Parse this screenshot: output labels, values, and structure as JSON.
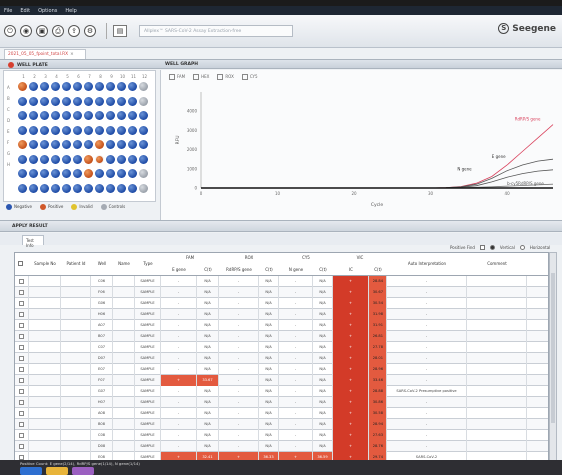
{
  "menu": [
    "File",
    "Edit",
    "Options",
    "Help"
  ],
  "assay_placeholder": "Allplex™ SARS-CoV-2 Assay Extraction-free",
  "brand": "Seegene",
  "doc_tab": "2021_05_05_fpoint_total.RX",
  "panels": {
    "well_plate": "WELL PLATE",
    "well_graph": "WELL GRAPH",
    "apply_result": "APPLY RESULT"
  },
  "chart_checks": [
    "FAM",
    "HEX",
    "ROX",
    "CY5"
  ],
  "plate": {
    "columns": [
      "1",
      "2",
      "3",
      "4",
      "5",
      "6",
      "7",
      "8",
      "9",
      "10",
      "11",
      "12"
    ],
    "rows": [
      "A",
      "B",
      "C",
      "D",
      "E",
      "F",
      "G",
      "H"
    ]
  },
  "plate_legend": [
    "Negative",
    "Positive",
    "Invalid",
    "Controls"
  ],
  "tab_test_info": "Test Info",
  "view_options": {
    "positive_find": "Positive Find",
    "vertical": "Vertical",
    "horizontal": "Horizontal"
  },
  "table": {
    "group_headers": [
      "FAM",
      "ROX",
      "CY5",
      "VIC"
    ],
    "headers": [
      "Sample No",
      "Patient Id",
      "Well",
      "Name",
      "Type",
      "E gene",
      "C(t)",
      "RdRP/S gene",
      "C(t)",
      "N gene",
      "C(t)",
      "IC",
      "C(t)",
      "Auto Interpretation",
      "Comment"
    ],
    "rows": [
      {
        "well": "C06",
        "type": "SAMPLE",
        "e": "-",
        "ect": "N/A",
        "r": "-",
        "rct": "N/A",
        "n": "-",
        "nct": "N/A",
        "ic": "+",
        "icct": "28.84",
        "interp": "-",
        "hl": []
      },
      {
        "well": "F06",
        "type": "SAMPLE",
        "e": "-",
        "ect": "N/A",
        "r": "-",
        "rct": "N/A",
        "n": "-",
        "nct": "N/A",
        "ic": "+",
        "icct": "30.67",
        "interp": "-",
        "hl": []
      },
      {
        "well": "G06",
        "type": "SAMPLE",
        "e": "-",
        "ect": "N/A",
        "r": "-",
        "rct": "N/A",
        "n": "-",
        "nct": "N/A",
        "ic": "+",
        "icct": "30.54",
        "interp": "-",
        "hl": []
      },
      {
        "well": "H06",
        "type": "SAMPLE",
        "e": "-",
        "ect": "N/A",
        "r": "-",
        "rct": "N/A",
        "n": "-",
        "nct": "N/A",
        "ic": "+",
        "icct": "31.98",
        "interp": "-",
        "hl": []
      },
      {
        "well": "A07",
        "type": "SAMPLE",
        "e": "-",
        "ect": "N/A",
        "r": "-",
        "rct": "N/A",
        "n": "-",
        "nct": "N/A",
        "ic": "+",
        "icct": "31.91",
        "interp": "-",
        "hl": []
      },
      {
        "well": "B07",
        "type": "SAMPLE",
        "e": "-",
        "ect": "N/A",
        "r": "-",
        "rct": "N/A",
        "n": "-",
        "nct": "N/A",
        "ic": "+",
        "icct": "26.81",
        "interp": "-",
        "hl": []
      },
      {
        "well": "C07",
        "type": "SAMPLE",
        "e": "-",
        "ect": "N/A",
        "r": "-",
        "rct": "N/A",
        "n": "-",
        "nct": "N/A",
        "ic": "+",
        "icct": "27.78",
        "interp": "-",
        "hl": []
      },
      {
        "well": "D07",
        "type": "SAMPLE",
        "e": "-",
        "ect": "N/A",
        "r": "-",
        "rct": "N/A",
        "n": "-",
        "nct": "N/A",
        "ic": "+",
        "icct": "28.01",
        "interp": "-",
        "hl": []
      },
      {
        "well": "E07",
        "type": "SAMPLE",
        "e": "-",
        "ect": "N/A",
        "r": "-",
        "rct": "N/A",
        "n": "-",
        "nct": "N/A",
        "ic": "+",
        "icct": "28.96",
        "interp": "-",
        "hl": []
      },
      {
        "well": "F07",
        "type": "SAMPLE",
        "e": "+",
        "ect": "33.67",
        "r": "-",
        "rct": "N/A",
        "n": "-",
        "nct": "N/A",
        "ic": "+",
        "icct": "33.46",
        "interp": "-",
        "hl": [
          "e"
        ]
      },
      {
        "well": "G07",
        "type": "SAMPLE",
        "e": "-",
        "ect": "N/A",
        "r": "-",
        "rct": "N/A",
        "n": "-",
        "nct": "N/A",
        "ic": "+",
        "icct": "28.88",
        "interp": "SARS-CoV-2 Presumptive positive",
        "hl": []
      },
      {
        "well": "H07",
        "type": "SAMPLE",
        "e": "-",
        "ect": "N/A",
        "r": "-",
        "rct": "N/A",
        "n": "-",
        "nct": "N/A",
        "ic": "+",
        "icct": "30.86",
        "interp": "-",
        "hl": []
      },
      {
        "well": "A08",
        "type": "SAMPLE",
        "e": "-",
        "ect": "N/A",
        "r": "-",
        "rct": "N/A",
        "n": "-",
        "nct": "N/A",
        "ic": "+",
        "icct": "30.58",
        "interp": "-",
        "hl": []
      },
      {
        "well": "B08",
        "type": "SAMPLE",
        "e": "-",
        "ect": "N/A",
        "r": "-",
        "rct": "N/A",
        "n": "-",
        "nct": "N/A",
        "ic": "+",
        "icct": "28.94",
        "interp": "-",
        "hl": []
      },
      {
        "well": "C08",
        "type": "SAMPLE",
        "e": "-",
        "ect": "N/A",
        "r": "-",
        "rct": "N/A",
        "n": "-",
        "nct": "N/A",
        "ic": "+",
        "icct": "27.63",
        "interp": "-",
        "hl": []
      },
      {
        "well": "D08",
        "type": "SAMPLE",
        "e": "-",
        "ect": "N/A",
        "r": "-",
        "rct": "N/A",
        "n": "-",
        "nct": "N/A",
        "ic": "+",
        "icct": "28.76",
        "interp": "-",
        "hl": []
      },
      {
        "well": "E08",
        "type": "SAMPLE",
        "e": "+",
        "ect": "32.41",
        "r": "+",
        "rct": "36.33",
        "n": "+",
        "nct": "36.59",
        "ic": "+",
        "icct": "29.74",
        "interp": "SARS-CoV-2",
        "hl": [
          "e",
          "r",
          "n"
        ]
      },
      {
        "well": "F08",
        "type": "SAMPLE",
        "e": "+",
        "ect": "",
        "r": "+",
        "rct": "",
        "n": "+",
        "nct": "",
        "ic": "+",
        "icct": "30.57",
        "interp": "",
        "hl": [
          "e",
          "r",
          "n"
        ],
        "sel": true
      },
      {
        "well": "G08",
        "type": "SAMPLE",
        "e": "-",
        "ect": "N/A",
        "r": "-",
        "rct": "N/A",
        "n": "-",
        "nct": "N/A",
        "ic": "+",
        "icct": "28.12",
        "interp": "SARS-CoV-2",
        "hl": []
      }
    ]
  },
  "status_text": "Positive Count: E gene(2/14), RdRP/S gene(1/14), N gene(1/14)",
  "chart_data": {
    "type": "line",
    "xlabel": "Cycle",
    "ylabel": "RFU",
    "xlim": [
      0,
      45
    ],
    "ylim": [
      0,
      5000
    ],
    "xticks": [
      0,
      10,
      20,
      30,
      40
    ],
    "yticks": [
      "4000",
      "3000",
      "2000",
      "1000",
      "0"
    ],
    "grid": false,
    "series": [
      {
        "name": "RdRP/S gene",
        "color": "#d9415c",
        "x": [
          0,
          30,
          32,
          34,
          36,
          38,
          40,
          42,
          44,
          46
        ],
        "y": [
          0,
          0,
          20,
          80,
          250,
          600,
          1200,
          1900,
          2600,
          3300
        ]
      },
      {
        "name": "E gene",
        "color": "#555555",
        "x": [
          0,
          30,
          32,
          34,
          36,
          38,
          40,
          42,
          44,
          46
        ],
        "y": [
          0,
          0,
          15,
          60,
          200,
          500,
          900,
          1200,
          1400,
          1500
        ]
      },
      {
        "name": "N gene",
        "color": "#555555",
        "x": [
          0,
          30,
          32,
          34,
          36,
          38,
          40,
          42,
          44,
          46
        ],
        "y": [
          0,
          0,
          10,
          40,
          120,
          320,
          560,
          750,
          880,
          950
        ]
      },
      {
        "name": "IC",
        "color": "#777777",
        "x": [
          0,
          30,
          34,
          38,
          42,
          46
        ],
        "y": [
          0,
          0,
          10,
          60,
          130,
          200
        ]
      },
      {
        "name": "",
        "color": "#111111",
        "x": [
          0,
          46
        ],
        "y": [
          0,
          0
        ]
      }
    ],
    "annotations": [
      "RdRP/S gene",
      "E gene",
      "N gene",
      "b-cy5RdRP/S gene"
    ]
  }
}
